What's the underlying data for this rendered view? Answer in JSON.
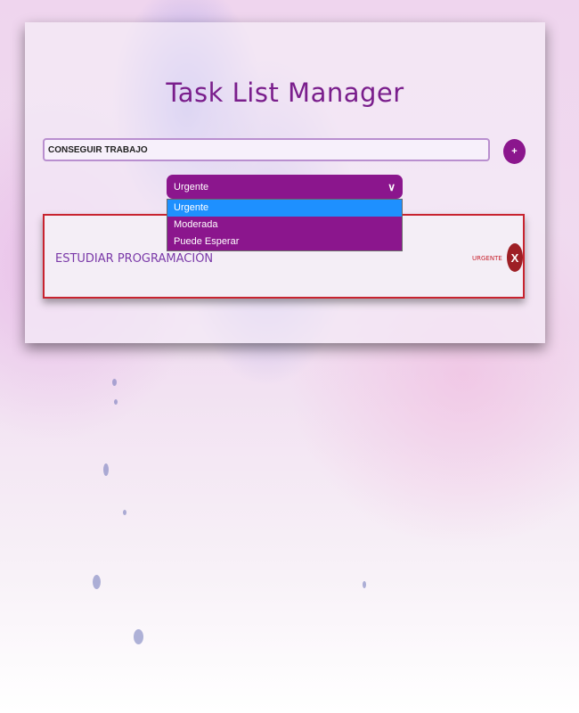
{
  "header": {
    "title": "Task List Manager"
  },
  "form": {
    "task_input_value": "CONSEGUIR TRABAJO",
    "add_button_label": "+",
    "priority_selected": "Urgente",
    "priority_options": [
      "Urgente",
      "Moderada",
      "Puede Esperar"
    ]
  },
  "tasks": [
    {
      "text": "ESTUDIAR PROGRAMACIÓN",
      "priority": "URGENTE",
      "delete_label": "X"
    }
  ],
  "colors": {
    "accent": "#8b168d",
    "title": "#7a1e8c",
    "urgent": "#c8232f",
    "highlight": "#1e90ff"
  },
  "icons": {
    "select": "chevron-down-icon"
  }
}
